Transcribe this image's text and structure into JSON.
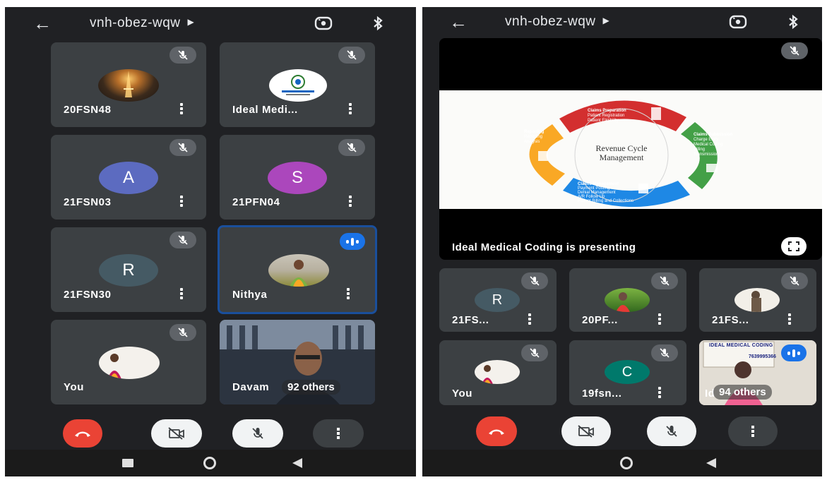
{
  "left_screen": {
    "meeting_code": "vnh-obez-wqw",
    "tiles": [
      {
        "name": "20FSN48",
        "kind": "photo",
        "photo": "eiffel-tower-night",
        "muted": true
      },
      {
        "name": "Ideal Medi...",
        "kind": "logo",
        "muted": true
      },
      {
        "name": "21FSN03",
        "kind": "letter",
        "letter": "A",
        "color": "#5c6bc0",
        "muted": true
      },
      {
        "name": "21PFN04",
        "kind": "letter",
        "letter": "S",
        "color": "#ab47bc",
        "muted": true
      },
      {
        "name": "21FSN30",
        "kind": "letter",
        "letter": "R",
        "color": "#455a64",
        "muted": true
      },
      {
        "name": "Nithya",
        "kind": "photo",
        "photo": "woman-green-saree",
        "speaking": true
      },
      {
        "name": "You",
        "kind": "photo",
        "photo": "woman-portrait",
        "muted": true
      },
      {
        "name": "Davam",
        "kind": "video",
        "others": "92 others"
      }
    ]
  },
  "right_screen": {
    "meeting_code": "vnh-obez-wqw",
    "presentation": {
      "label": "Ideal Medical Coding is presenting",
      "slide": {
        "center_text_1": "Revenue Cycle",
        "center_text_2": "Management",
        "sections": [
          {
            "title": "Claims Preparation",
            "bullets": [
              "Patient Registration",
              "Patient Eligibility"
            ],
            "color": "#d32f2f"
          },
          {
            "title": "Claims Submission",
            "bullets": [
              "Charge Entry",
              "Medical Coding",
              "Billing",
              "Transmission"
            ],
            "color": "#43a047"
          },
          {
            "title": "Claims Management",
            "bullets": [
              "Payment Posting",
              "Denial Management",
              "A/R Follow Up",
              "Patient Billing and Collections"
            ],
            "color": "#1e88e5"
          },
          {
            "title": "Reporting",
            "bullets": [
              "Reporting",
              "Analysis"
            ],
            "color": "#f9a825"
          }
        ]
      }
    },
    "tiles": [
      {
        "name": "21FS...",
        "kind": "letter",
        "letter": "R",
        "color": "#455a64",
        "muted": true
      },
      {
        "name": "20PF...",
        "kind": "photo",
        "photo": "child-outdoors",
        "muted": true
      },
      {
        "name": "21FS...",
        "kind": "photo",
        "photo": "statue",
        "muted": true
      },
      {
        "name": "You",
        "kind": "photo",
        "photo": "woman-portrait",
        "muted": true
      },
      {
        "name": "19fsn...",
        "kind": "letter",
        "letter": "C",
        "color": "#00796b",
        "muted": true
      },
      {
        "name": "Id",
        "kind": "video",
        "others": "94 others",
        "video_text_1": "IDEAL MEDICAL CODING",
        "video_text_2": "7639995366",
        "speaking": true
      }
    ]
  },
  "colors": {
    "background": "#202124",
    "tile": "#3c4043",
    "end_call": "#ea4335",
    "speaking": "#1a73e8"
  }
}
